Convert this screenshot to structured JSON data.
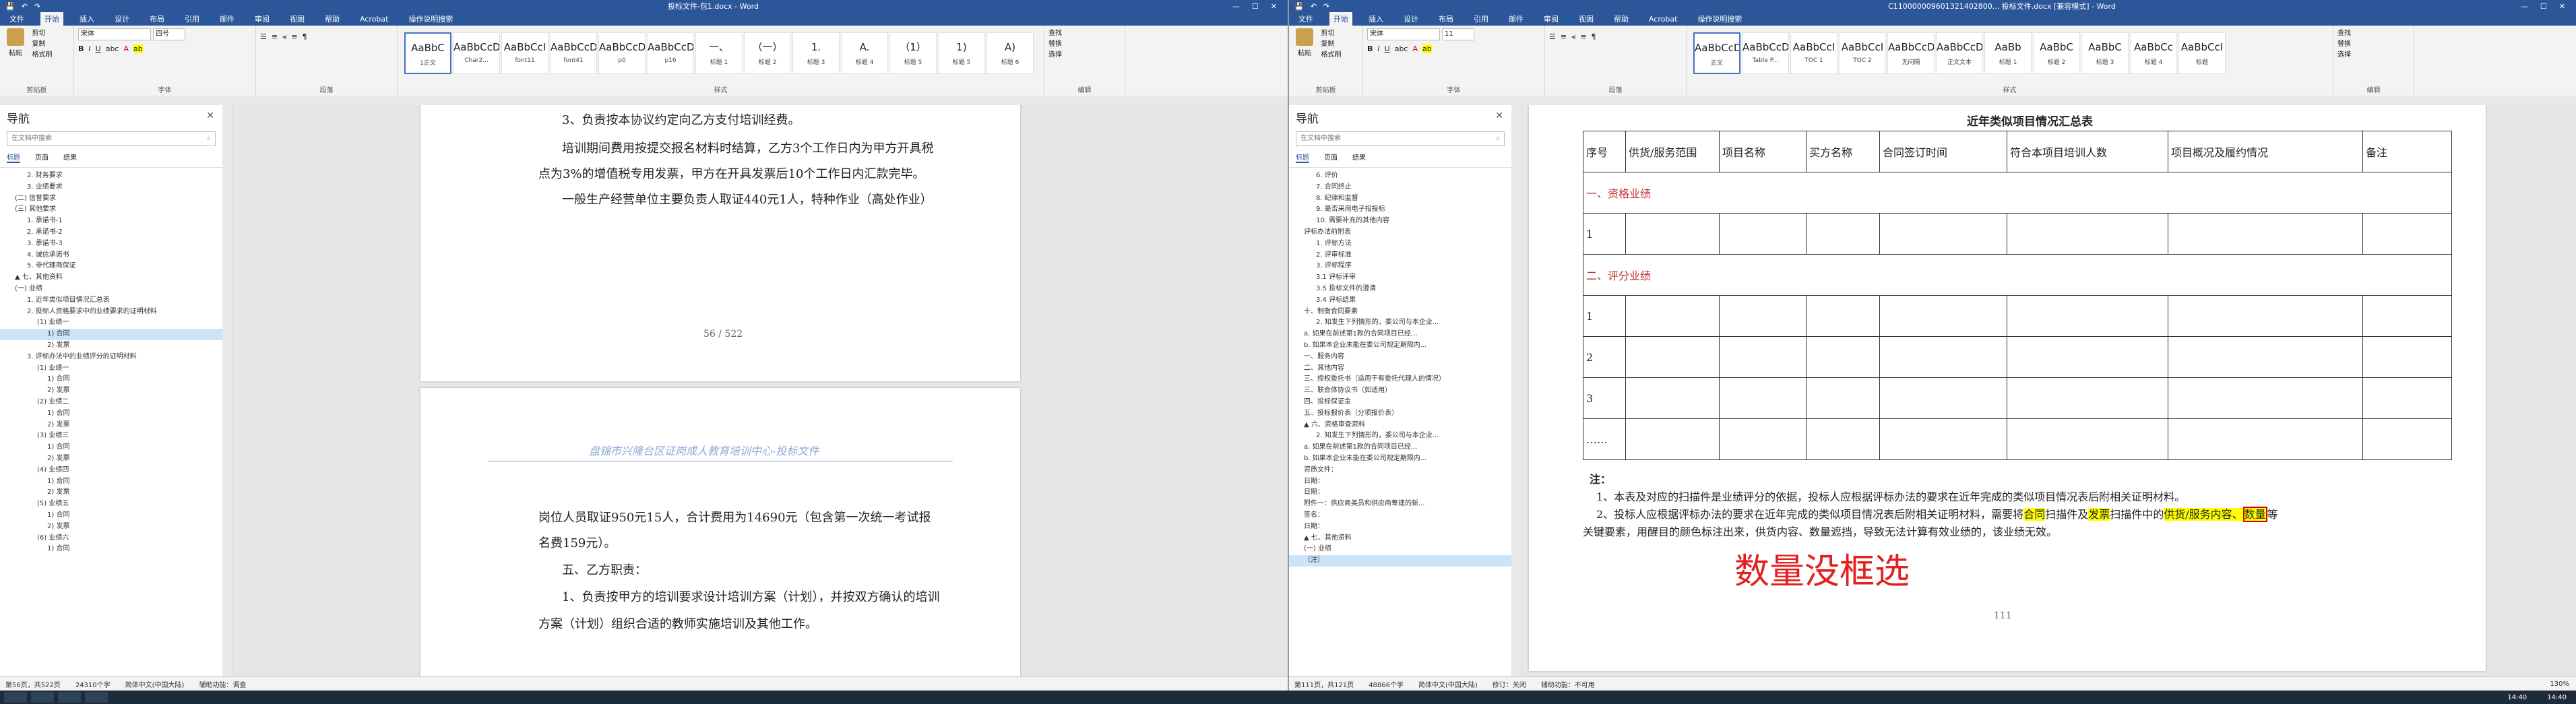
{
  "left": {
    "title": "投标文件-包1.docx - Word",
    "menus": [
      "文件",
      "开始",
      "插入",
      "设计",
      "布局",
      "引用",
      "邮件",
      "审阅",
      "视图",
      "帮助",
      "Acrobat",
      "操作说明搜索"
    ],
    "font_name": "宋体",
    "font_size": "四号",
    "clipboard": [
      "粘贴",
      "剪切",
      "复制",
      "格式刷"
    ],
    "group_names": [
      "剪贴板",
      "字体",
      "段落",
      "样式",
      "编辑"
    ],
    "styles": [
      {
        "prev": "AaBbC",
        "name": "1正文"
      },
      {
        "prev": "AaBbCcDd",
        "name": "Char2..."
      },
      {
        "prev": "AaBbCcI",
        "name": "font11"
      },
      {
        "prev": "AaBbCcD",
        "name": "font41"
      },
      {
        "prev": "AaBbCcDc",
        "name": "p0"
      },
      {
        "prev": "AaBbCcDc",
        "name": "p16"
      },
      {
        "prev": "一、",
        "name": "标题 1"
      },
      {
        "prev": "（一）",
        "name": "标题 2"
      },
      {
        "prev": "1.",
        "name": "标题 3"
      },
      {
        "prev": "A.",
        "name": "标题 4"
      },
      {
        "prev": "（1）",
        "name": "标题 5"
      },
      {
        "prev": "1)",
        "name": "标题 5"
      },
      {
        "prev": "A)",
        "name": "标题 6"
      }
    ],
    "editing": [
      "查找",
      "替换",
      "选择"
    ],
    "nav_title": "导航",
    "nav_search": "在文档中搜索",
    "nav_tabs": [
      "标题",
      "页面",
      "结果"
    ],
    "tree": [
      "2. 财务要求",
      "3. 业绩要求",
      "(二) 信誉要求",
      "(三) 其他要求",
      "1. 承诺书-1",
      "2. 承诺书-2",
      "3. 承诺书-3",
      "4. 诚信承诺书",
      "5. 非代理商保证",
      "▲ 七、其他资料",
      "(一) 业绩",
      "1. 近年类似项目情况汇总表",
      "2. 投标人资格要求中的业绩要求的证明材料",
      "(1) 业绩一",
      "1) 合同",
      "2) 发票",
      "3. 评标办法中的业绩评分的证明材料",
      "(1) 业绩一",
      "1) 合同",
      "2) 发票",
      "(2) 业绩二",
      "1) 合同",
      "2) 发票",
      "(3) 业绩三",
      "1) 合同",
      "2) 发票",
      "(4) 业绩四",
      "1) 合同",
      "2) 发票",
      "(5) 业绩五",
      "1) 合同",
      "2) 发票",
      "(6) 业绩六",
      "1) 合同"
    ],
    "tree_selected": 14,
    "page1_lines": [
      "3、负责按本协议约定向乙方支付培训经费。",
      "培训期间费用按提交报名材料时结算，乙方3个工作日内为甲方开具税",
      "点为3%的增值税专用发票，甲方在开具发票后10个工作日内汇款完毕。",
      "一般生产经营单位主要负责人取证440元1人，特种作业（高处作业）"
    ],
    "page_number": "56 / 522",
    "page2_header": "盘锦市兴隆台区证岗成人教育培训中心-投标文件",
    "page2_lines": [
      "岗位人员取证950元15人，合计费用为14690元（包含第一次统一考试报",
      "名费159元）。",
      "五、乙方职责：",
      "1、负责按甲方的培训要求设计培训方案（计划），并按双方确认的培训",
      "方案（计划）组织合适的教师实施培训及其他工作。"
    ],
    "status": [
      "第56页，共522页",
      "24310个字",
      "简体中文(中国大陆)",
      "辅助功能：调查"
    ]
  },
  "right": {
    "title": "C110000009601321402800... 投标文件.docx [兼容模式] - Word",
    "menus": [
      "文件",
      "开始",
      "插入",
      "设计",
      "布局",
      "引用",
      "邮件",
      "审阅",
      "视图",
      "帮助",
      "Acrobat",
      "操作说明搜索"
    ],
    "font_name": "宋体",
    "font_size": "11",
    "styles": [
      {
        "prev": "AaBbCcDc",
        "name": "正文"
      },
      {
        "prev": "AaBbCcDc",
        "name": "Table P..."
      },
      {
        "prev": "AaBbCcI",
        "name": "TOC 1"
      },
      {
        "prev": "AaBbCcI",
        "name": "TOC 2"
      },
      {
        "prev": "AaBbCcDc",
        "name": "无间隔"
      },
      {
        "prev": "AaBbCcDc",
        "name": "正文文本"
      },
      {
        "prev": "AaBb",
        "name": "标题 1"
      },
      {
        "prev": "AaBbC",
        "name": "标题 2"
      },
      {
        "prev": "AaBbC",
        "name": "标题 3"
      },
      {
        "prev": "AaBbCc",
        "name": "标题 4"
      },
      {
        "prev": "AaBbCcI",
        "name": "标题"
      }
    ],
    "nav_title": "导航",
    "nav_search": "在文档中搜索",
    "nav_tabs": [
      "标题",
      "页面",
      "结果"
    ],
    "tree": [
      "6. 评价",
      "7. 合同终止",
      "8. 纪律和监督",
      "9. 是否采用电子招投标",
      "10. 需要补充的其他内容",
      "评标办法前附表",
      "1. 评标方法",
      "2. 评审标准",
      "3. 评标程序",
      "3.1 评标评审",
      "3.5 投标文件的澄清",
      "3.4 评标结果",
      "十、制衡合同要素",
      "2. 知发生下列情形的，委公司与本企业...",
      "a. 如果在前述第1款的合同项目已经...",
      "b. 如果本企业未能在委公司规定期限内...",
      "一、服务内容",
      "二、其他内容",
      "三、授权委托书（适用于有委托代理人的情况）",
      "三、联合体协议书（如适用）",
      "四、投标保证金",
      "五、投标报价表（分项报价表）",
      "▲ 六、资格审查资料",
      "2. 知发生下列情形的，委公司与本企业...",
      "a. 如果在前述第1款的合同项目已经...",
      "b. 如果本企业未能在委公司规定期限内...",
      "资质文件：",
      "日期：",
      "日期：",
      "附件一：供应商类员和供应商筹建的新...",
      "签名：",
      "日期：",
      "▲ 七、其他资料",
      "(一) 业绩",
      "（注）"
    ],
    "tree_selected": 34,
    "table_title": "近年类似项目情况汇总表",
    "headers": [
      "序号",
      "供货/服务范围",
      "项目名称",
      "买方名称",
      "合同签订时间",
      "符合本项目培训人数",
      "项目概况及履约情况",
      "备注"
    ],
    "section1": "一、资格业绩",
    "section2": "二、评分业绩",
    "rows1": [
      "1"
    ],
    "rows2": [
      "1",
      "2",
      "3",
      "……"
    ],
    "notes_label": "注：",
    "note1": "1、本表及对应的扫描件是业绩评分的依据，投标人应根据评标办法的要求在近年完成的类似项目情况表后附相关证明材料。",
    "note2_a": "2、投标人应根据评标办法的要求在近年完成的类似项目情况表后附相关证明材料，需要将",
    "note2_hl1": "合同",
    "note2_b": "扫描件及",
    "note2_hl2": "发票",
    "note2_c": "扫描件中的",
    "note2_hl3": "供货/服务内容、",
    "note2_hl4": "数量",
    "note2_d": "等",
    "note3": "关键要素，用醒目的颜色标注出来，供货内容、数量遮挡，导致无法计算有效业绩的，该业绩无效。",
    "annotation": "数量没框选",
    "page_number": "111",
    "status": [
      "第111页，共121页",
      "48866个字",
      "简体中文(中国大陆)",
      "修订：关闭",
      "辅助功能：不可用"
    ],
    "zoom": "130%"
  },
  "taskbar": {
    "time1": "14:40",
    "time2": "14:40"
  }
}
